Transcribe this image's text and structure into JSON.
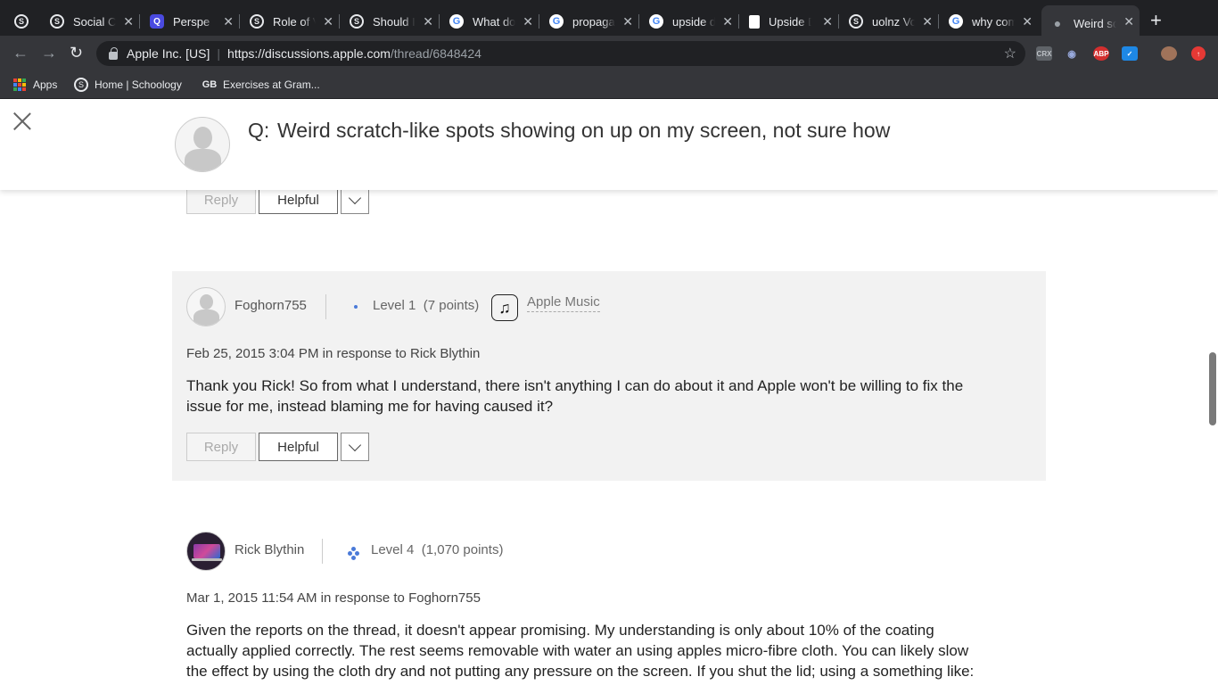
{
  "browser": {
    "tabs": [
      {
        "title": "",
        "icon": "schoology-icon"
      },
      {
        "title": "Social Cl",
        "icon": "schoology-icon"
      },
      {
        "title": "Perspe",
        "icon": "quizlet-icon"
      },
      {
        "title": "Role of V",
        "icon": "schoology-icon"
      },
      {
        "title": "Should I",
        "icon": "schoology-icon"
      },
      {
        "title": "What do",
        "icon": "google-icon"
      },
      {
        "title": "propaga",
        "icon": "google-icon"
      },
      {
        "title": "upside d",
        "icon": "google-icon"
      },
      {
        "title": "Upside D",
        "icon": "doc-icon"
      },
      {
        "title": "uolnz Vo",
        "icon": "schoology-icon"
      },
      {
        "title": "why com",
        "icon": "google-icon"
      },
      {
        "title": "Weird sc",
        "icon": "apple-icon",
        "active": true
      }
    ],
    "address": {
      "org": "Apple Inc. [US]",
      "host": "https://discussions.apple.com",
      "path": "/thread/6848424"
    },
    "bookmarks": [
      {
        "label": "Apps",
        "icon": "apps-grid-icon"
      },
      {
        "label": "Home | Schoology",
        "icon": "schoology-icon"
      },
      {
        "label": "Exercises at Gram...",
        "icon": "gb-icon"
      }
    ],
    "extensions": [
      "CRX",
      "ABP"
    ]
  },
  "header": {
    "q_label": "Q:",
    "question_title": "Weird scratch-like spots showing on up on my screen, not sure how"
  },
  "buttons": {
    "reply": "Reply",
    "helpful": "Helpful"
  },
  "posts": [
    {
      "author": "Foghorn755",
      "level": "Level 1",
      "points": "(7 points)",
      "community": "Apple Music",
      "date": "Feb 25, 2015 3:04 PM",
      "in_response": "in response to",
      "responder": "Rick Blythin",
      "body": "Thank you Rick! So from what I understand, there isn't anything I can do about it and Apple won't be willing to fix the issue for me, instead blaming me for having caused it?"
    },
    {
      "author": "Rick Blythin",
      "level": "Level 4",
      "points": "(1,070 points)",
      "date": "Mar 1, 2015 11:54 AM",
      "in_response": "in response to",
      "responder": "Foghorn755",
      "body": "Given the reports on the thread, it doesn't appear promising. My understanding is only about 10% of the coating actually applied correctly. The rest seems removable with water an using apples micro-fibre cloth. You can likely slow the effect by using the cloth dry and not putting any pressure on the screen. If you shut the lid; using a something like: Radtech"
    }
  ]
}
